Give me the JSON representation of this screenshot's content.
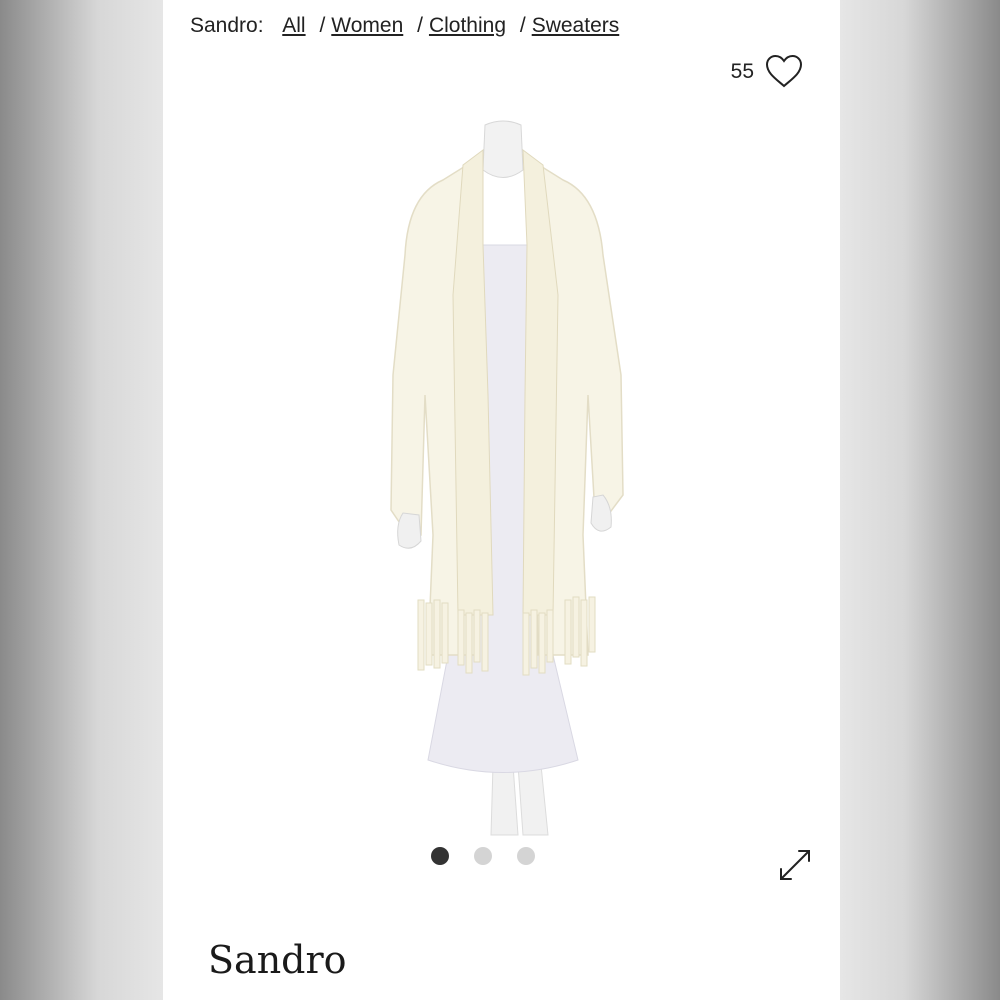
{
  "breadcrumb": {
    "brand": "Sandro:",
    "links": [
      "All",
      "Women",
      "Clothing",
      "Sweaters"
    ]
  },
  "favorites": {
    "count": "55",
    "icon": "heart-outline-icon"
  },
  "gallery": {
    "image": "cream fringed scarf cardigan on mannequin over white dress",
    "slides": 3,
    "active_index": 0,
    "expand_icon": "expand-arrows-icon"
  },
  "product": {
    "brand_name": "Sandro"
  },
  "colors": {
    "text": "#222222",
    "dot_active": "#333333",
    "dot_inactive": "#d4d4d4",
    "garment": "#f7f4e6"
  }
}
